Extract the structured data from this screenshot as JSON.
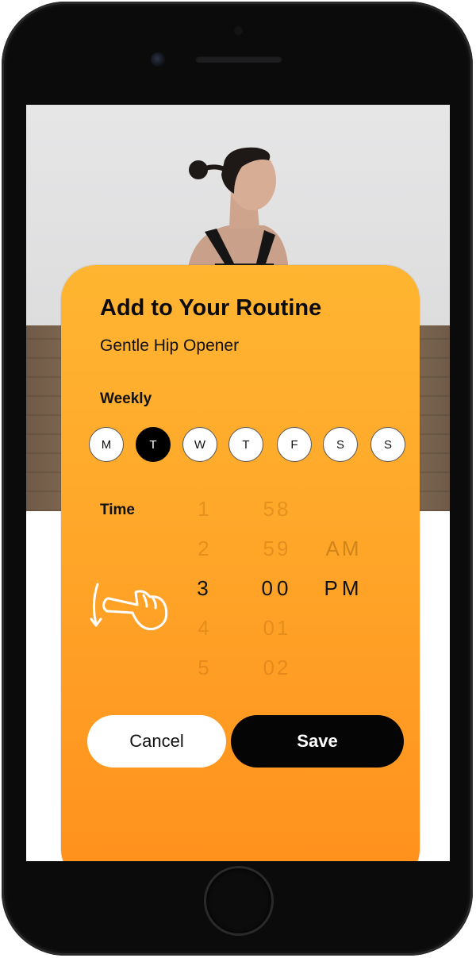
{
  "card": {
    "title": "Add to Your Routine",
    "subtitle": "Gentle Hip Opener",
    "weekly_label": "Weekly",
    "days": [
      {
        "label": "M",
        "selected": false
      },
      {
        "label": "T",
        "selected": true
      },
      {
        "label": "W",
        "selected": false
      },
      {
        "label": "T",
        "selected": false
      },
      {
        "label": "F",
        "selected": false
      },
      {
        "label": "S",
        "selected": false
      },
      {
        "label": "S",
        "selected": false
      }
    ],
    "time_label": "Time",
    "picker": {
      "hours": [
        "1",
        "2",
        "3",
        "4",
        "5"
      ],
      "minutes": [
        "58",
        "59",
        "00",
        "01",
        "02"
      ],
      "ampm": [
        "AM",
        "PM"
      ],
      "selected": {
        "hour": "3",
        "minute": "00",
        "ampm": "PM"
      }
    },
    "cancel_label": "Cancel",
    "save_label": "Save"
  },
  "icons": {
    "swipe_hint": "hand-swipe-icon"
  },
  "colors": {
    "card_top": "#ffb531",
    "card_bottom": "#ff901c",
    "selected_day": "#000000",
    "save_button": "#050505"
  }
}
